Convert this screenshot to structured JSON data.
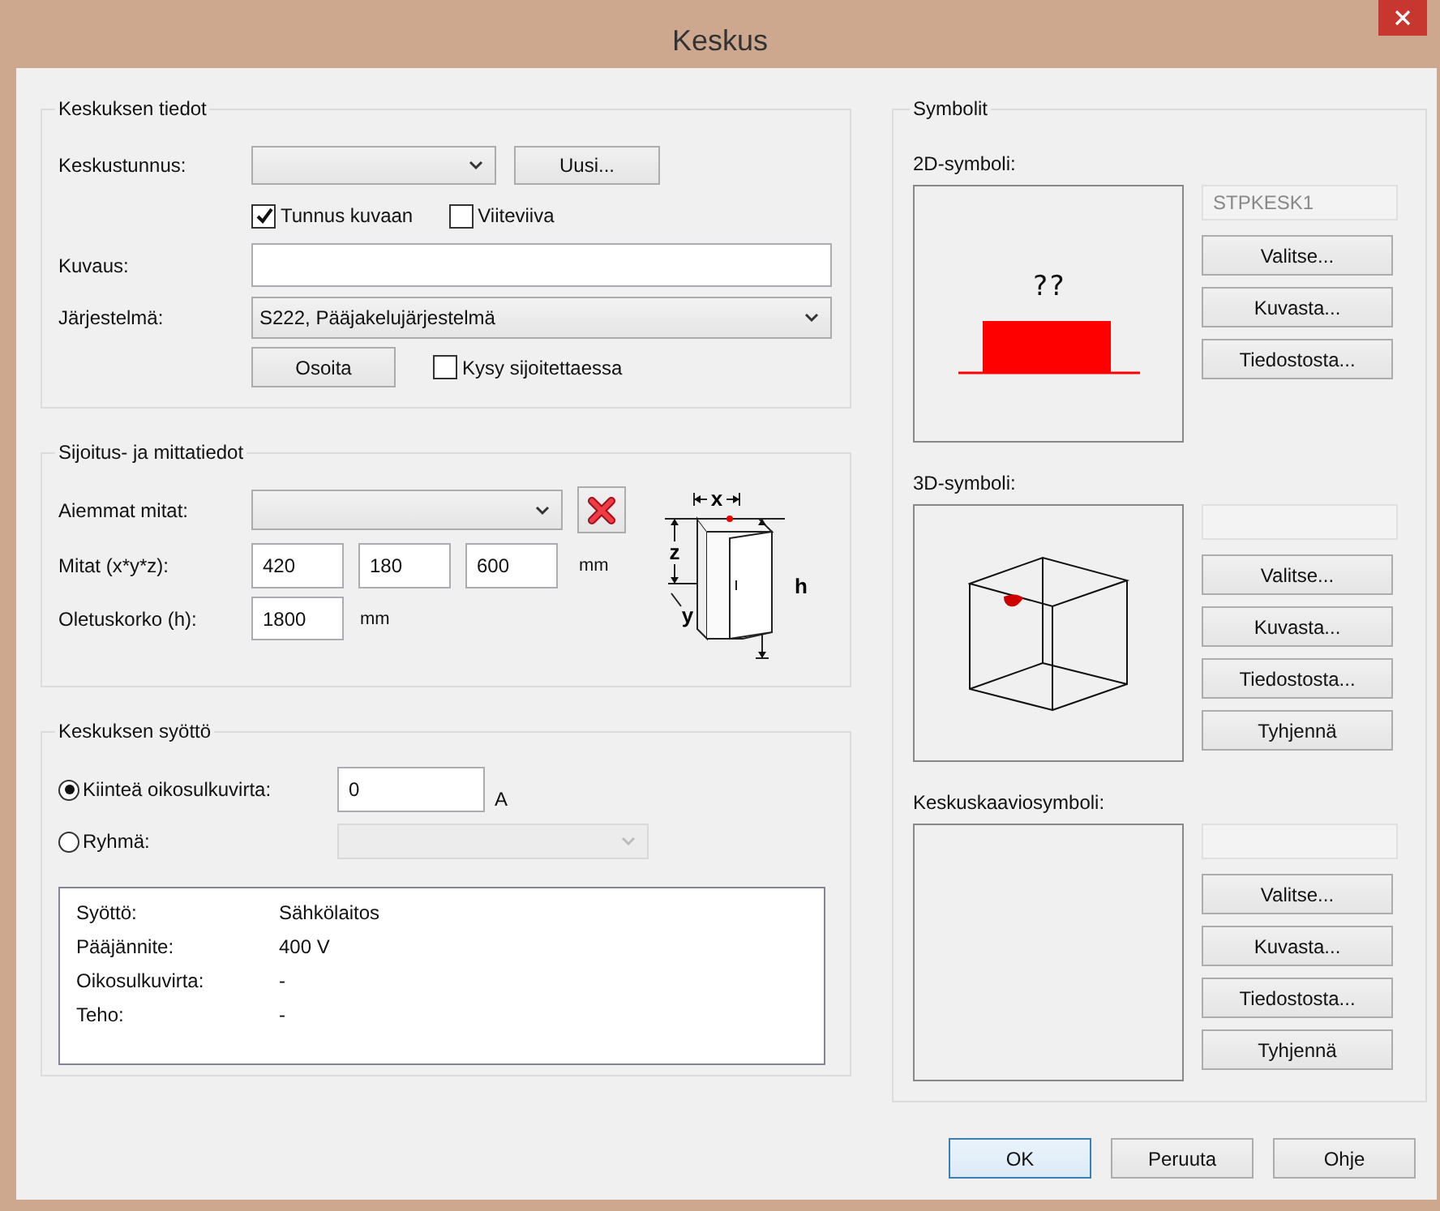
{
  "window": {
    "title": "Keskus"
  },
  "keskuksen_tiedot": {
    "title": "Keskuksen tiedot",
    "keskustunnus_label": "Keskustunnus:",
    "new_button": "Uusi...",
    "checkboxes": [
      {
        "label": "Tunnus kuvaan",
        "checked": true
      },
      {
        "label": "Viiteviiva",
        "checked": false
      }
    ],
    "kuvaus_label": "Kuvaus:",
    "jarjestelma": {
      "label": "Järjestelmä:",
      "value": "S222, Pääjakelujärjestelmä"
    },
    "point_button": "Osoita",
    "ask_checkbox": {
      "label": "Kysy sijoitettaessa",
      "checked": false
    }
  },
  "sijoitus": {
    "title": "Sijoitus- ja mittatiedot",
    "aiemmat_label": "Aiemmat mitat:",
    "mitat": {
      "label": "Mitat (x*y*z):",
      "values": [
        "420",
        "180",
        "600"
      ],
      "unit": "mm"
    },
    "oletuskorko": {
      "label": "Oletuskorko (h):",
      "value": "1800",
      "unit": "mm"
    },
    "dimension_labels": [
      "x",
      "z",
      "h",
      "y"
    ]
  },
  "syotto": {
    "title": "Keskuksen syöttö",
    "options": [
      {
        "label": "Kiinteä oikosulkuvirta:",
        "selected": true,
        "kind": "input",
        "value": "0",
        "unit": "A"
      },
      {
        "label": "Ryhmä:",
        "selected": false,
        "kind": "dropdown",
        "disabled": true
      }
    ],
    "info": [
      {
        "label": "Syöttö:",
        "value": "Sähkölaitos"
      },
      {
        "label": "Pääjännite:",
        "value": "400 V"
      },
      {
        "label": "Oikosulkuvirta:",
        "value": "-"
      },
      {
        "label": "Teho:",
        "value": "-"
      }
    ]
  },
  "symbolit": {
    "title": "Symbolit",
    "panels": [
      {
        "label": "2D-symboli:",
        "kind": "planar",
        "preview_text": "??",
        "name_field": "STPKESK1",
        "buttons": [
          "Valitse...",
          "Kuvasta...",
          "Tiedostosta..."
        ]
      },
      {
        "label": "3D-symboli:",
        "kind": "cube",
        "buttons": [
          "Valitse...",
          "Kuvasta...",
          "Tiedostosta...",
          "Tyhjennä"
        ]
      },
      {
        "label": "Keskuskaaviosymboli:",
        "kind": "empty",
        "buttons": [
          "Valitse...",
          "Kuvasta...",
          "Tiedostosta...",
          "Tyhjennä"
        ]
      }
    ]
  },
  "buttons": [
    {
      "label": "OK",
      "default": true
    },
    {
      "label": "Peruuta",
      "default": false
    },
    {
      "label": "Ohje",
      "default": false
    }
  ]
}
